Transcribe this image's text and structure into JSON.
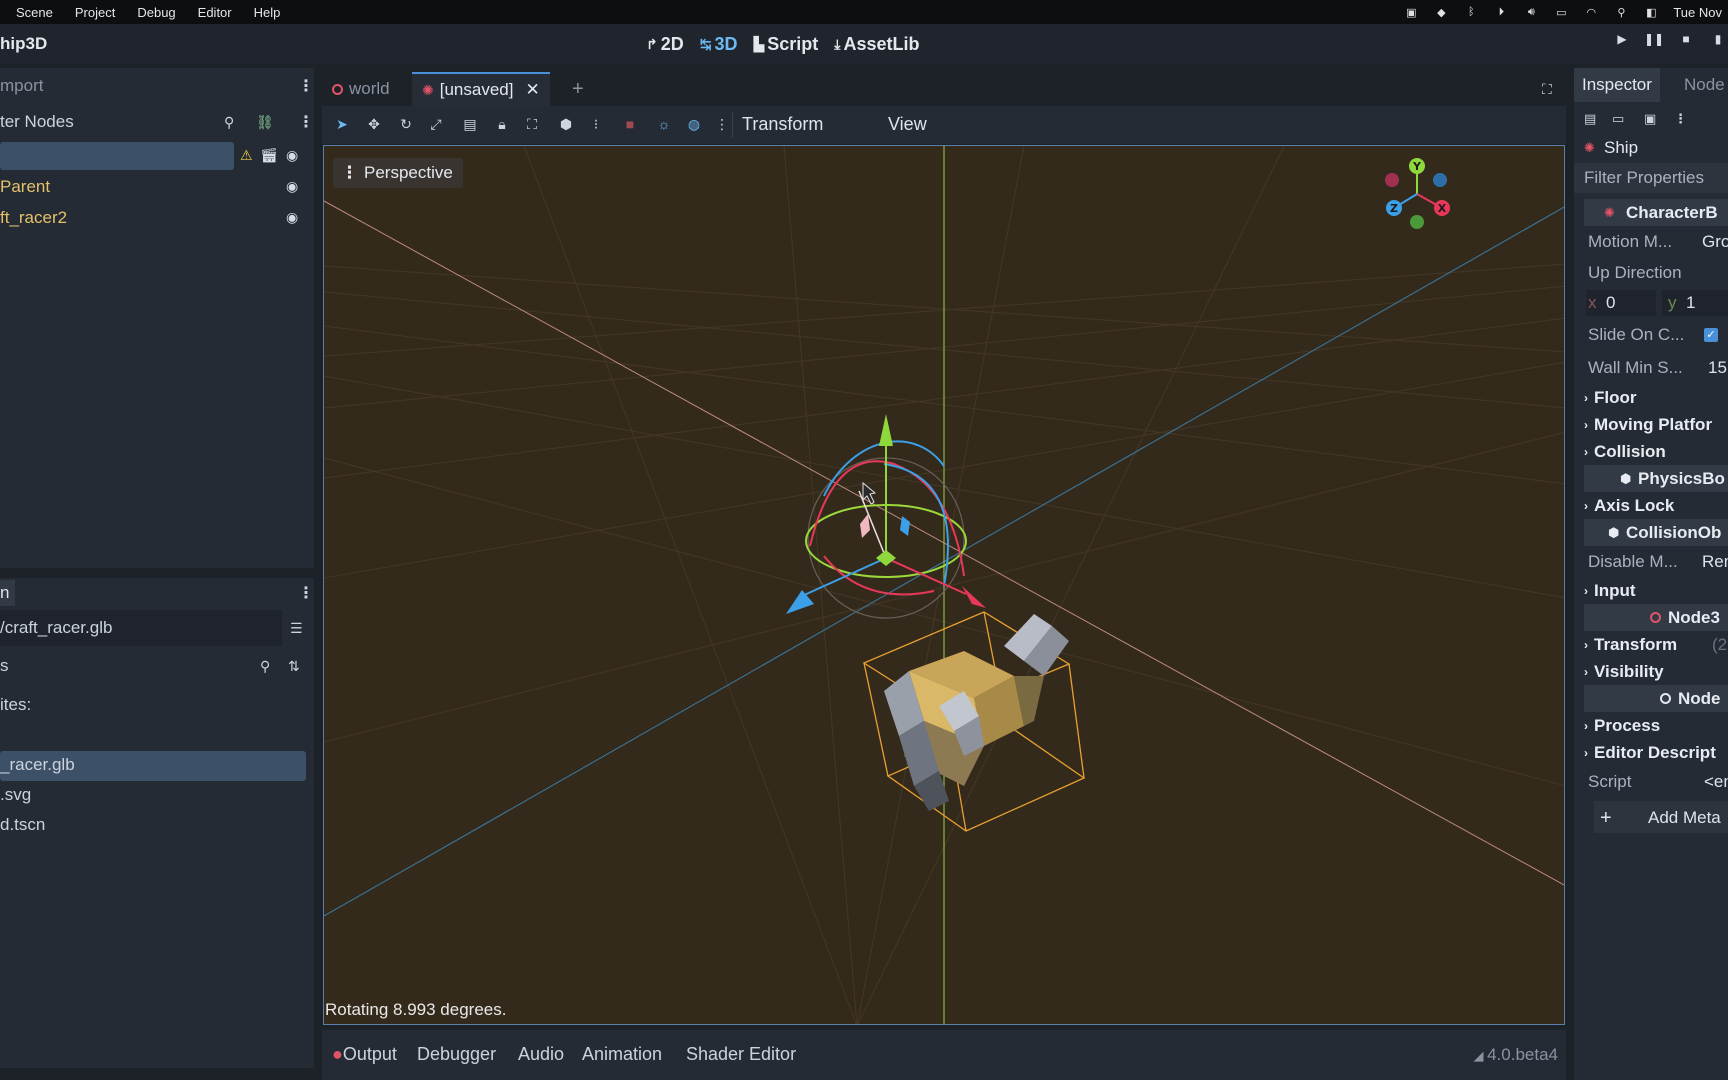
{
  "menubar": {
    "items": [
      "Scene",
      "Project",
      "Debug",
      "Editor",
      "Help"
    ],
    "clock": "Tue Nov"
  },
  "editor": {
    "project_title": "hip3D",
    "workspaces": {
      "2d": "2D",
      "3d": "3D",
      "script": "Script",
      "assetlib": "AssetLib"
    },
    "active_workspace": "3D"
  },
  "scene_dock": {
    "tab_label": "mport",
    "filter_placeholder": "ter Nodes",
    "tree": [
      {
        "label": "",
        "selected": true,
        "warning": true
      },
      {
        "label": "Parent",
        "selected": false
      },
      {
        "label": "ft_racer2",
        "selected": false
      }
    ]
  },
  "filesystem_dock": {
    "tab_label": "n",
    "path": "/craft_racer.glb",
    "search_placeholder": "s",
    "favorites_label": "ites:",
    "files": [
      {
        "name": "_racer.glb",
        "selected": true
      },
      {
        "name": ".svg",
        "selected": false
      },
      {
        "name": "d.tscn",
        "selected": false
      }
    ]
  },
  "scene_tabs": {
    "tabs": [
      {
        "label": "world",
        "active": false
      },
      {
        "label": "[unsaved]",
        "active": true
      }
    ]
  },
  "toolbar": {
    "transform_menu": "Transform",
    "view_menu": "View"
  },
  "viewport": {
    "perspective_label": "Perspective",
    "status": "Rotating 8.993 degrees.",
    "gizmo_axes": {
      "x": "X",
      "y": "Y",
      "z": "Z"
    },
    "colors": {
      "background": "#342a1c",
      "x_axis": "#e8385a",
      "y_axis": "#8fd83b",
      "z_axis": "#3ca0e8",
      "selection_box": "#e8a030"
    }
  },
  "bottom_panel": {
    "tabs": [
      "Output",
      "Debugger",
      "Audio",
      "Animation",
      "Shader Editor"
    ],
    "version": "4.0.beta4"
  },
  "inspector": {
    "tabs": [
      "Inspector",
      "Node"
    ],
    "node_name": "Ship",
    "filter_placeholder": "Filter Properties",
    "class_characterbody": "CharacterB",
    "motion_mode_label": "Motion M...",
    "motion_mode_value": "Gro",
    "up_direction_label": "Up Direction",
    "up_x_label": "x",
    "up_x_value": "0",
    "up_y_label": "y",
    "up_y_value": "1",
    "slide_label": "Slide On C...",
    "wall_min_label": "Wall Min S...",
    "wall_min_value": "15",
    "floor": "Floor",
    "moving_platform": "Moving Platfor",
    "collision": "Collision",
    "class_physicsbody": "PhysicsBo",
    "axis_lock": "Axis Lock",
    "class_collisionobject": "CollisionOb",
    "disable_mode_label": "Disable M...",
    "disable_mode_value": "Rem",
    "input": "Input",
    "class_node3d": "Node3",
    "transform": "Transform",
    "transform_hint": "(2",
    "visibility": "Visibility",
    "class_node": "Node",
    "process": "Process",
    "editor_description": "Editor Descript",
    "script_label": "Script",
    "script_value": "<em",
    "add_metadata": "Add Meta"
  }
}
